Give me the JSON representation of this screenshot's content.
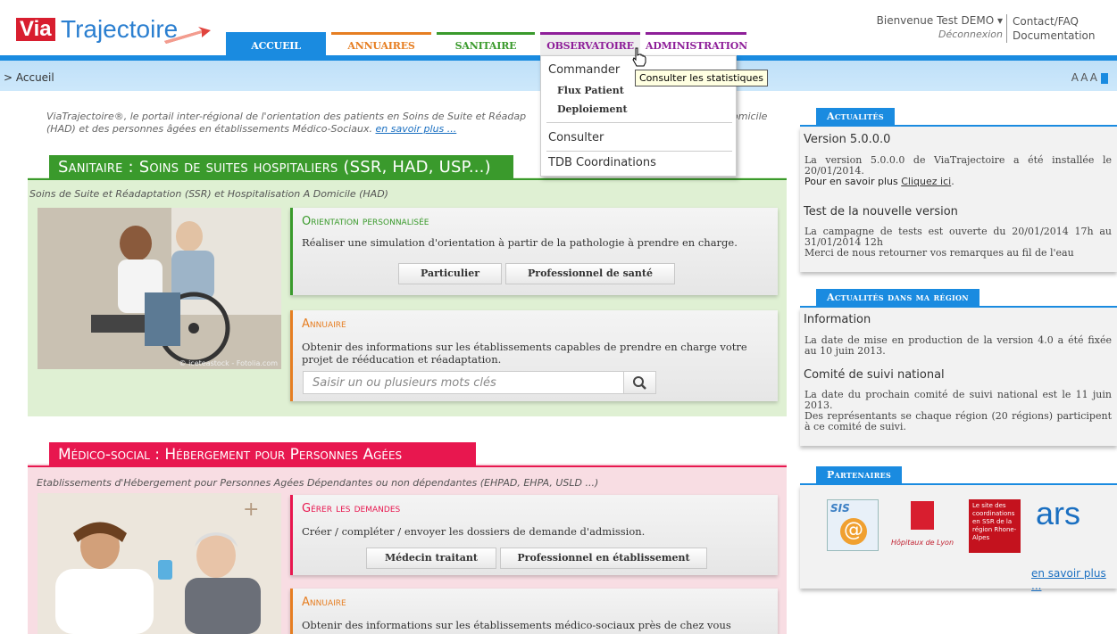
{
  "logo": {
    "box": "Via",
    "text": "Trajectoire"
  },
  "nav": {
    "accueil": "ACCUEIL",
    "annuaires": "ANNUAIRES",
    "sanitaire": "SANITAIRE",
    "observatoire": "OBSERVATOIRE",
    "administration": "ADMINISTRATION"
  },
  "user": {
    "welcome": "Bienvenue Test DEMO",
    "logout": "Déconnexion",
    "contact": "Contact/FAQ",
    "documentation": "Documentation"
  },
  "breadcrumb": "> Accueil",
  "font_size_label": "AAA",
  "intro": {
    "text": "ViaTrajectoire®, le portail inter-régional de l'orientation des patients en Soins de Suite et Réadap",
    "text2": "(HAD) et des personnes âgées en établissements Médico-Sociaux.",
    "link": "en savoir plus ...",
    "tail": "omicile"
  },
  "sanitaire": {
    "title": "Sanitaire : Soins de suites hospitaliers (SSR, HAD, USP...)",
    "subtitle": "Soins de Suite et Réadaptation (SSR) et Hospitalisation A Domicile (HAD)",
    "photo_credit": "© iceteastock - Fotolia.com",
    "orientation": {
      "title": "Orientation personnalisée",
      "desc": "Réaliser une simulation d'orientation à partir de la pathologie à prendre en charge.",
      "btn_particulier": "Particulier",
      "btn_pro": "Professionnel de santé"
    },
    "annuaire": {
      "title": "Annuaire",
      "desc": "Obtenir des informations sur les établissements capables de prendre en charge votre projet de rééducation et réadaptation.",
      "search_placeholder": "Saisir un ou plusieurs mots clés"
    }
  },
  "medico": {
    "title": "Médico-social : Hébergement pour Personnes Agées",
    "subtitle": "Etablissements d'Hébergement pour Personnes Agées Dépendantes ou non dépendantes (EHPAD, EHPA, USLD ...)",
    "gerer": {
      "title": "Gérer les demandes",
      "desc": "Créer / compléter / envoyer les dossiers de demande d'admission.",
      "btn_medecin": "Médecin traitant",
      "btn_pro": "Professionnel en établissement"
    },
    "annuaire": {
      "title": "Annuaire",
      "desc": "Obtenir des informations sur les établissements médico-sociaux près de chez vous"
    }
  },
  "actualites": {
    "heading": "Actualités",
    "items": [
      {
        "title": "Version 5.0.0.0",
        "desc": "La version 5.0.0.0 de ViaTrajectoire a été installée le 20/01/2014.",
        "desc2": "Pour en savoir plus",
        "link": "Cliquez ici"
      },
      {
        "title": "Test de la nouvelle version",
        "desc": "La campagne de tests est ouverte du 20/01/2014 17h au 31/01/2014 12h",
        "desc2": "Merci de nous retourner vos remarques au fil de l'eau"
      }
    ]
  },
  "region": {
    "heading": "Actualités dans ma région",
    "items": [
      {
        "title": "Information",
        "desc": "La date de mise en production de la version 4.0 a été fixée au 10 juin 2013."
      },
      {
        "title": "Comité de suivi national",
        "desc": "La date du prochain comité de suivi national est le 11 juin 2013.",
        "desc2": "Des représentants se chaque région (20 régions) participent à ce comité de suivi."
      }
    ]
  },
  "partenaires": {
    "heading": "Partenaires",
    "sis": "SIS",
    "hcl": "Hôpitaux de Lyon",
    "ssr": "Le site des coordinations en SSR de la région Rhone-Alpes",
    "ars": "ars",
    "more": "en savoir plus ..."
  },
  "dropdown": {
    "commander": "Commander",
    "flux": "Flux Patient",
    "deploiement": "Deploiement",
    "consulter": "Consulter",
    "tdb": "TDB Coordinations",
    "tooltip": "Consulter les statistiques"
  },
  "colors": {
    "blue": "#1a8be0",
    "green": "#3a9a2c",
    "pink": "#e8174f",
    "orange": "#e67e22",
    "purple": "#8e1f99",
    "red": "#d81e2f"
  }
}
